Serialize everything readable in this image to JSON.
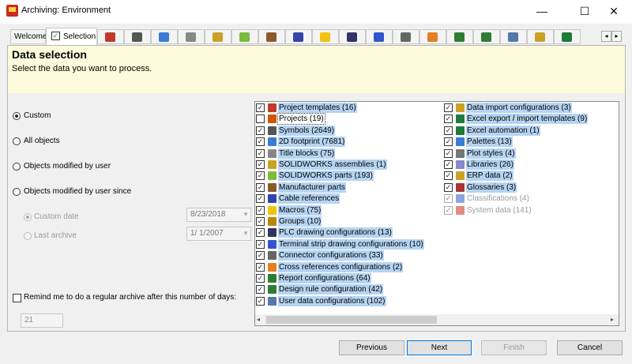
{
  "window": {
    "title": "Archiving: Environment",
    "controls": {
      "minimize": "—",
      "maximize": "☐",
      "close": "✕"
    }
  },
  "tabs": [
    {
      "label": "Welcome",
      "type": "text"
    },
    {
      "label": "Selection",
      "type": "text",
      "active": true
    },
    {
      "icon": "project-templates-icon",
      "color": "#c0392b"
    },
    {
      "icon": "symbols-icon",
      "color": "#555555"
    },
    {
      "icon": "footprint-icon",
      "color": "#3a7bd5"
    },
    {
      "icon": "title-block-icon",
      "color": "#888888"
    },
    {
      "icon": "assembly-icon",
      "color": "#c9a227"
    },
    {
      "icon": "parts-icon",
      "color": "#7dbb3c"
    },
    {
      "icon": "manufacturer-parts-icon",
      "color": "#8b5a2b"
    },
    {
      "icon": "cable-icon",
      "color": "#3344aa"
    },
    {
      "icon": "macros-icon",
      "color": "#f1c40f"
    },
    {
      "icon": "plc-icon",
      "color": "#333366"
    },
    {
      "icon": "terminal-strip-icon",
      "color": "#3355cc"
    },
    {
      "icon": "connector-icon",
      "color": "#666666"
    },
    {
      "icon": "cross-ref-icon",
      "color": "#e67e22"
    },
    {
      "icon": "report-icon",
      "color": "#2e7d32"
    },
    {
      "icon": "design-rule-icon",
      "color": "#2e7d32"
    },
    {
      "icon": "user-data-icon",
      "color": "#5577aa"
    },
    {
      "icon": "data-import-icon",
      "color": "#c9a227"
    },
    {
      "icon": "excel-icon",
      "color": "#1e7b3a"
    }
  ],
  "header": {
    "title": "Data selection",
    "subtitle": "Select the data you want to process."
  },
  "options": {
    "custom": "Custom",
    "all_objects": "All objects",
    "modified_by_user": "Objects modified by user",
    "modified_since": "Objects modified by user since",
    "custom_date": "Custom date",
    "custom_date_value": "8/23/2018",
    "last_archive": "Last archive",
    "last_archive_value": "1/  1/2007",
    "remind_label": "Remind me to do a regular archive after this number of days:",
    "remind_days": "21",
    "selected": "custom"
  },
  "list": {
    "column1": [
      {
        "label": "Project templates (16)",
        "checked": true,
        "icon": "project-templates-icon",
        "color": "#c0392b"
      },
      {
        "label": "Projects (19)",
        "checked": false,
        "focused": true,
        "icon": "projects-icon",
        "color": "#d35400"
      },
      {
        "label": "Symbols (2649)",
        "checked": true,
        "icon": "symbols-icon",
        "color": "#555555"
      },
      {
        "label": "2D footprint (7681)",
        "checked": true,
        "icon": "footprint-icon",
        "color": "#3a7bd5"
      },
      {
        "label": "Title blocks (75)",
        "checked": true,
        "icon": "title-block-icon",
        "color": "#888888"
      },
      {
        "label": "SOLIDWORKS assemblies (1)",
        "checked": true,
        "icon": "assembly-icon",
        "color": "#c9a227"
      },
      {
        "label": "SOLIDWORKS parts (193)",
        "checked": true,
        "icon": "parts-icon",
        "color": "#7dbb3c"
      },
      {
        "label": "Manufacturer parts",
        "checked": true,
        "icon": "manufacturer-parts-icon",
        "color": "#8b5a2b"
      },
      {
        "label": "Cable references",
        "checked": true,
        "icon": "cable-icon",
        "color": "#3344aa"
      },
      {
        "label": "Macros (75)",
        "checked": true,
        "icon": "macros-icon",
        "color": "#f1c40f"
      },
      {
        "label": "Groups (10)",
        "checked": true,
        "icon": "groups-icon",
        "color": "#b8860b"
      },
      {
        "label": "PLC drawing configurations (13)",
        "checked": true,
        "icon": "plc-icon",
        "color": "#333366"
      },
      {
        "label": "Terminal strip drawing configurations (10)",
        "checked": true,
        "icon": "terminal-strip-icon",
        "color": "#3355cc"
      },
      {
        "label": "Connector configurations (33)",
        "checked": true,
        "icon": "connector-icon",
        "color": "#666666"
      },
      {
        "label": "Cross references configurations (2)",
        "checked": true,
        "icon": "cross-ref-icon",
        "color": "#e67e22"
      },
      {
        "label": "Report configurations (64)",
        "checked": true,
        "icon": "report-icon",
        "color": "#2e7d32"
      },
      {
        "label": "Design rule configuration (42)",
        "checked": true,
        "icon": "design-rule-icon",
        "color": "#2e7d32"
      },
      {
        "label": "User data configurations (102)",
        "checked": true,
        "icon": "user-data-icon",
        "color": "#5577aa"
      }
    ],
    "column2": [
      {
        "label": "Data import configurations (3)",
        "checked": true,
        "icon": "data-import-icon",
        "color": "#c9a227"
      },
      {
        "label": "Excel export / import templates (9)",
        "checked": true,
        "icon": "excel-templates-icon",
        "color": "#1e7b3a"
      },
      {
        "label": "Excel automation (1)",
        "checked": true,
        "icon": "excel-automation-icon",
        "color": "#1e7b3a"
      },
      {
        "label": "Palettes (13)",
        "checked": true,
        "icon": "palettes-icon",
        "color": "#3a7bd5"
      },
      {
        "label": "Plot styles (4)",
        "checked": true,
        "icon": "plot-styles-icon",
        "color": "#777777"
      },
      {
        "label": "Libraries (26)",
        "checked": true,
        "icon": "libraries-icon",
        "color": "#8888cc"
      },
      {
        "label": "ERP data (2)",
        "checked": true,
        "icon": "erp-icon",
        "color": "#c9a227"
      },
      {
        "label": "Glossaries (3)",
        "checked": true,
        "icon": "glossaries-icon",
        "color": "#aa3333"
      },
      {
        "label": "Classifications (4)",
        "checked": true,
        "disabled": true,
        "icon": "classifications-icon",
        "color": "#3355cc"
      },
      {
        "label": "System data (141)",
        "checked": true,
        "disabled": true,
        "icon": "system-data-icon",
        "color": "#cc2a1a"
      }
    ]
  },
  "buttons": {
    "previous": "Previous",
    "next": "Next",
    "finish": "Finish",
    "cancel": "Cancel"
  }
}
